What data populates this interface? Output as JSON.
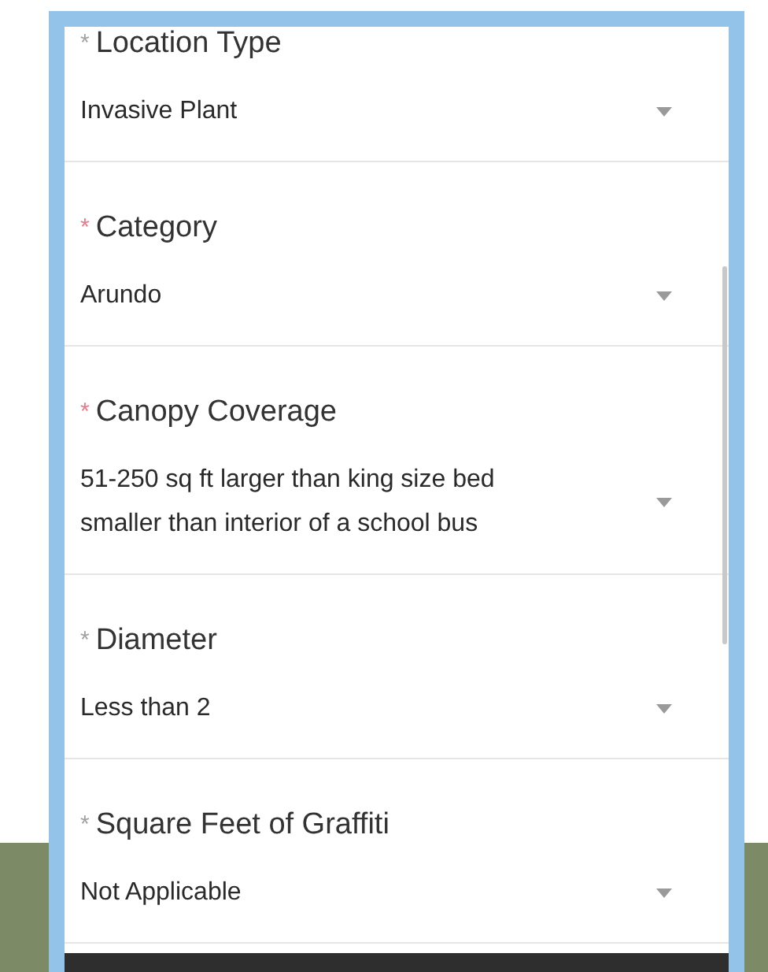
{
  "fields": [
    {
      "mark": "*",
      "label": "Location Type",
      "value": "Invasive Plant",
      "color": "#a0a0a0"
    },
    {
      "mark": "*",
      "label": "Category",
      "value": "Arundo",
      "color": "#e8788a"
    },
    {
      "mark": "*",
      "label": "Canopy Coverage",
      "value": "51-250 sq ft larger than king size bed smaller than interior of a school bus",
      "color": "#e8788a"
    },
    {
      "mark": "*",
      "label": "Diameter",
      "value": "Less than 2",
      "color": "#a0a0a0"
    },
    {
      "mark": "*",
      "label": "Square Feet of Graffiti",
      "value": "Not Applicable",
      "color": "#a0a0a0"
    }
  ]
}
